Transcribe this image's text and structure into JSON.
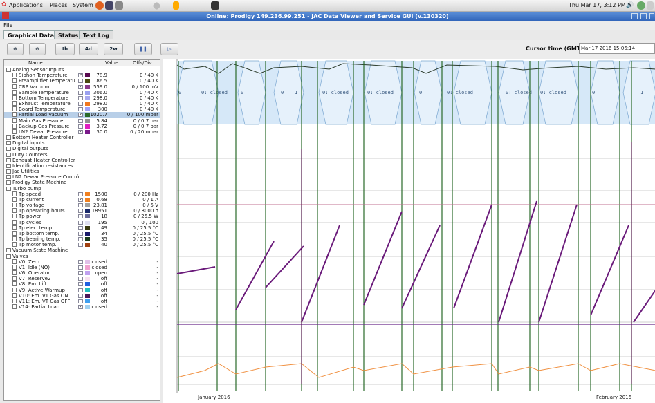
{
  "system_bar": {
    "menus": [
      "Applications",
      "Places",
      "System"
    ],
    "clock": "Thu Mar 17,  3:12 PM"
  },
  "window": {
    "title": "Online: Prodigy 149.236.99.251 - JAC Data Viewer and Service GUI (v.130320)"
  },
  "menubar": {
    "file": "File"
  },
  "tabs": [
    {
      "label": "Graphical Data",
      "active": true
    },
    {
      "label": "Status",
      "active": false
    },
    {
      "label": "Text Log",
      "active": false
    }
  ],
  "toolbar": {
    "buttons": [
      "",
      "",
      "th",
      "4d",
      "2w",
      "",
      ""
    ],
    "cursor_label": "Cursor time (GMT):",
    "cursor_value": "Mar 17 2016 15:06:14"
  },
  "table": {
    "headers": {
      "name": "Name",
      "value": "Value",
      "offs": "Offs/Div"
    },
    "rows": [
      {
        "type": "group",
        "name": "Analog Sensor Inputs",
        "indent": 0
      },
      {
        "type": "item",
        "name": "Siphon Temperature",
        "checked": true,
        "color": "#5a0a50",
        "value": "78.9",
        "offs": "0 / 40 K"
      },
      {
        "type": "item",
        "name": "Preamplifier Temperatu",
        "checked": false,
        "color": "#4a4a10",
        "value": "86.5",
        "offs": "0 / 40 K"
      },
      {
        "type": "item",
        "name": "CRP Vacuum",
        "checked": true,
        "color": "#8a3a8a",
        "value": "559.0",
        "offs": "0 / 100 mV"
      },
      {
        "type": "item",
        "name": "Sample Temperature",
        "checked": false,
        "color": "#9aa0f0",
        "value": "306.0",
        "offs": "0 / 40 K"
      },
      {
        "type": "item",
        "name": "Bottom Temperature",
        "checked": false,
        "color": "#a8a8f0",
        "value": "298.0",
        "offs": "0 / 40 K"
      },
      {
        "type": "item",
        "name": "Exhaust Temperature",
        "checked": false,
        "color": "#f07820",
        "value": "298.0",
        "offs": "0 / 40 K"
      },
      {
        "type": "item",
        "name": "Board Temperature",
        "checked": false,
        "color": "#a0a0f8",
        "value": "300",
        "offs": "0 / 40 K"
      },
      {
        "type": "item",
        "name": "Partial Load Vacuum",
        "checked": true,
        "color": "#2a6a2a",
        "value": "1020.7",
        "offs": "0 / 100 mbar",
        "selected": true
      },
      {
        "type": "item",
        "name": "Main Gas Pressure",
        "checked": false,
        "color": "#909090",
        "value": "5.84",
        "offs": "0 / 0.7 bar"
      },
      {
        "type": "item",
        "name": "Backup Gas Pressure",
        "checked": false,
        "color": "#e020c0",
        "value": "3.72",
        "offs": "0 / 0.7 bar"
      },
      {
        "type": "item",
        "name": "LN2 Dewar Pressure",
        "checked": true,
        "color": "#7a1a8a",
        "value": "30.0",
        "offs": "0 / 20 mbar"
      },
      {
        "type": "group",
        "name": "Bottom Heater Controller",
        "indent": 0
      },
      {
        "type": "group",
        "name": "Digital inputs",
        "indent": 0
      },
      {
        "type": "group",
        "name": "Digital outputs",
        "indent": 0
      },
      {
        "type": "group",
        "name": "Duty Counters",
        "indent": 0
      },
      {
        "type": "group",
        "name": "Exhaust Heater Controller",
        "indent": 0
      },
      {
        "type": "group",
        "name": "Identification resistances",
        "indent": 0
      },
      {
        "type": "group",
        "name": "Jac Utilities",
        "indent": 0
      },
      {
        "type": "group",
        "name": "LN2 Dewar Pressure Contrö",
        "indent": 0
      },
      {
        "type": "group",
        "name": "Prodigy State Machine",
        "indent": 0
      },
      {
        "type": "group",
        "name": "Turbo pump",
        "indent": 0
      },
      {
        "type": "item",
        "name": "Tp speed",
        "checked": false,
        "color": "#f08020",
        "value": "1500",
        "offs": "0 / 200 Hz"
      },
      {
        "type": "item",
        "name": "Tp current",
        "checked": true,
        "color": "#f08020",
        "value": "0.68",
        "offs": "0 / 1 A"
      },
      {
        "type": "item",
        "name": "Tp voltage",
        "checked": false,
        "color": "#a0a0a0",
        "value": "23.81",
        "offs": "0 / 5 V"
      },
      {
        "type": "item",
        "name": "Tp operating hours",
        "checked": false,
        "color": "#1a2a6a",
        "value": "18951",
        "offs": "0 / 8000 h"
      },
      {
        "type": "item",
        "name": "Tp power",
        "checked": false,
        "color": "#6a6a9a",
        "value": "18",
        "offs": "0 / 25.5 W"
      },
      {
        "type": "item",
        "name": "Tp cycles",
        "checked": false,
        "color": "#e0e0f0",
        "value": "195",
        "offs": "0 / 100"
      },
      {
        "type": "item",
        "name": "Tp elec. temp.",
        "checked": false,
        "color": "#3a3a10",
        "value": "49",
        "offs": "0 / 25.5 °C"
      },
      {
        "type": "item",
        "name": "Tp bottom temp.",
        "checked": false,
        "color": "#1a1a6a",
        "value": "34",
        "offs": "0 / 25.5 °C"
      },
      {
        "type": "item",
        "name": "Tp bearing temp.",
        "checked": false,
        "color": "#1a3a1a",
        "value": "35",
        "offs": "0 / 25.5 °C"
      },
      {
        "type": "item",
        "name": "Tp motor temp.",
        "checked": false,
        "color": "#a04010",
        "value": "40",
        "offs": "0 / 25.5 °C"
      },
      {
        "type": "group",
        "name": "Vacuum State Machine",
        "indent": 0
      },
      {
        "type": "group",
        "name": "Valves",
        "indent": 0
      },
      {
        "type": "item",
        "name": "V0: Zero",
        "checked": false,
        "color": "#e0c0e8",
        "value": "closed",
        "offs": "-"
      },
      {
        "type": "item",
        "name": "V1: Idle (NO)",
        "checked": false,
        "color": "#f0a0d0",
        "value": "closed",
        "offs": "-"
      },
      {
        "type": "item",
        "name": "V6: Operator",
        "checked": false,
        "color": "#c0a0f0",
        "value": "open",
        "offs": "-"
      },
      {
        "type": "item",
        "name": "V7: Reserve2",
        "checked": false,
        "color": "#f8e0f0",
        "value": "off",
        "offs": "-"
      },
      {
        "type": "item",
        "name": "V8: Em. Lift",
        "checked": false,
        "color": "#2060e0",
        "value": "off",
        "offs": "-"
      },
      {
        "type": "item",
        "name": "V9: Active Warmup",
        "checked": false,
        "color": "#20c0c0",
        "value": "off",
        "offs": "-"
      },
      {
        "type": "item",
        "name": "V10: Em. VT Gas ON",
        "checked": false,
        "color": "#4a1a5a",
        "value": "off",
        "offs": "-"
      },
      {
        "type": "item",
        "name": "V11: Em. VT Gas OFF",
        "checked": false,
        "color": "#40a0f0",
        "value": "off",
        "offs": "-"
      },
      {
        "type": "item",
        "name": "V14: Partial Load",
        "checked": true,
        "color": "#a0d0f0",
        "value": "closed",
        "offs": "-"
      }
    ]
  },
  "plot": {
    "valve_labels": [
      "0",
      "0: closed",
      "0",
      "0",
      "1",
      "0: closed",
      "0: closed",
      "0",
      "0: closed",
      "0: closed",
      "0: closed",
      "0",
      "1"
    ],
    "x_labels": [
      "January 2016",
      "February 2016"
    ]
  }
}
